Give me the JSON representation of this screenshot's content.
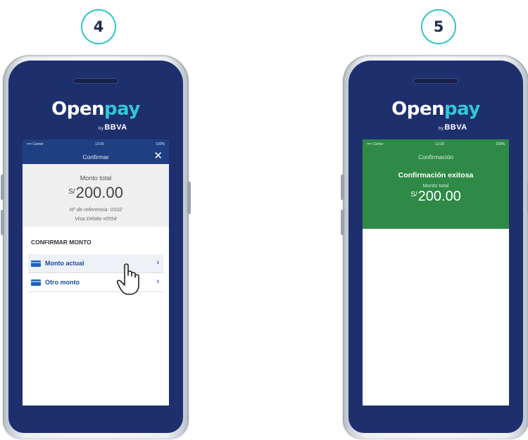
{
  "steps": [
    {
      "number": "4"
    },
    {
      "number": "5"
    }
  ],
  "logo": {
    "open": "Open",
    "pay": "pay",
    "by_small": "by",
    "by": "BBVA"
  },
  "screen4": {
    "status": {
      "left": "•••• Carrier",
      "time": "13:30",
      "right": "100%"
    },
    "nav_title": "Confirmar",
    "summary": {
      "label": "Monto total",
      "currency": "S/",
      "amount": "200.00",
      "reference": "Nº de referencia: 0102",
      "card": "Visa Débito •0554"
    },
    "section_title": "CONFIRMAR MONTO",
    "options": [
      {
        "label": "Monto actual"
      },
      {
        "label": "Otro monto"
      }
    ]
  },
  "screen5": {
    "status": {
      "left": "•••• Carrier",
      "time": "13:30",
      "right": "100%"
    },
    "nav_title": "Confirmación",
    "success": "Confirmación exitosa",
    "label": "Monto total",
    "currency": "S/",
    "amount": "200.00"
  },
  "colors": {
    "brand_navy": "#1e2f6e",
    "accent_teal": "#2ec4c8",
    "success_green": "#2e8a46"
  }
}
